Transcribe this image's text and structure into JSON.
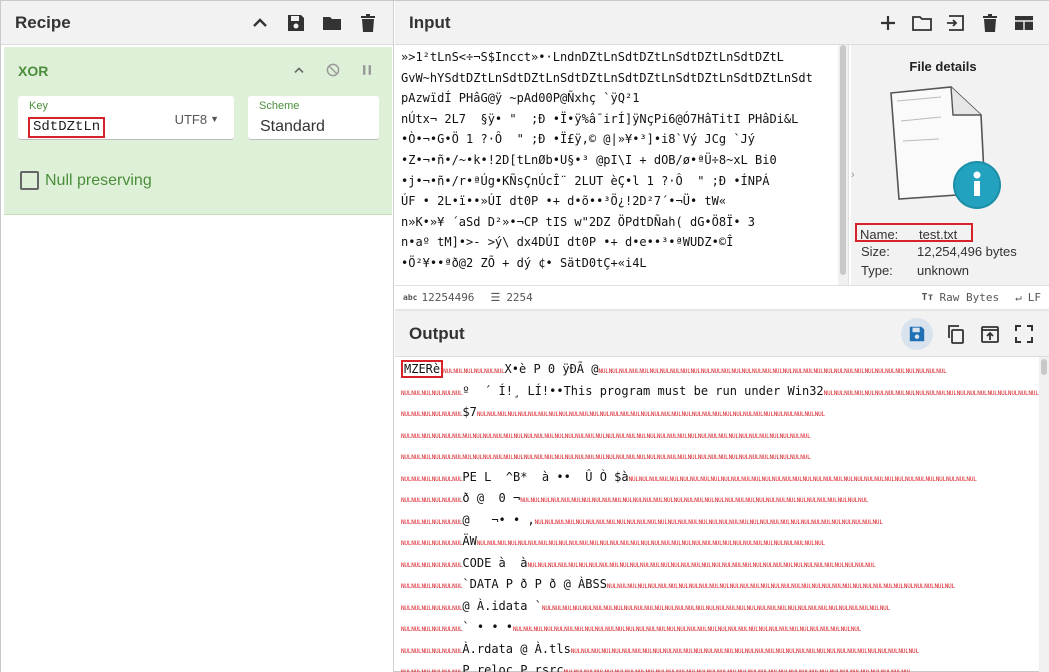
{
  "recipe": {
    "title": "Recipe",
    "operation": {
      "name": "XOR",
      "key_label": "Key",
      "key_value": "SdtDZtLn",
      "key_encoding": "UTF8",
      "scheme_label": "Scheme",
      "scheme_value": "Standard",
      "null_preserving_label": "Null preserving",
      "null_preserving_checked": false
    }
  },
  "input": {
    "title": "Input",
    "lines": [
      "»>1²tLnS<÷¬S$Incct»•·LndnDZtLnSdtDZtLnSdtDZtLnSdtDZtL",
      "GvW~hYSdtDZtLnSdtDZtLnSdtDZtLnSdtDZtLnSdtDZtLnSdtDZtLnSdt",
      "pAzwïdÍ PHâG@ÿ ~pAd00P@Ñxhç `ÿQ²1",
      "nÚtx¬ 2L7  §ÿ• \"  ;Ð •Ï•ÿ%â¯irÍ]ÿNçPi6@Ó7HâTitI PHâDi&L",
      "•Ò•¬•G•Ö 1 ?·Ô  \" ;Ð •Ï£ÿ,© @|»¥•³]•i8`Vý JCg `Jý",
      "•Z•¬•ñ•/~•k•!2D[tLnØb•U§•³ @pI\\I + dOB/ø•ªÜ÷8~xL Bi0",
      "•j•¬•ñ•/r•ªÚg•KÑsÇnÚcÎ¨ 2LUT èÇ•l 1 ?·Ô  \" ;Ð •ÍNPÁ",
      "ÚF • 2L•ï••»ÚI dt0P •+ d•õ••³Ö¿!2D²7´•¬Ü• tW«",
      "n»K•»¥ ´aSd D²»•¬CP tIS w\"2DZ ÖPdtDÑah( dG•Ö8Ï• 3",
      "n•aº tM]•>- >ý\\ dx4DÚI dt0P •+ d•e••³•ªWUDZ•©Î",
      "•Ö²¥••ªð@2 ZÕ + dý ¢• SätD0tÇ+«i4L"
    ],
    "char_count": "12254496",
    "line_count": "2254",
    "raw_bytes_label": "Raw Bytes",
    "file_details": {
      "title": "File details",
      "name_label": "Name:",
      "name_value": "test.txt",
      "size_label": "Size:",
      "size_value": "12,254,496 bytes",
      "type_label": "Type:",
      "type_value": "unknown"
    }
  },
  "output": {
    "title": "Output",
    "first_token": "MZERè",
    "lines": [
      "X•è P 0 ÿÐÃ @",
      "º  ´ Í!¸ LÍ!••This program must be run under Win32",
      "$7",
      "",
      "",
      "PE L  ^B*  à ••  Û Ò $à",
      "ð @  0 ¬",
      "@   ¬• • ,",
      "ÄW",
      "CODE à  à",
      "`DATA P ð P ð @ ÀBSS",
      "@ À.idata `",
      "` • • •",
      "À.rdata @ À.tls",
      "P.reloc P.rsrc"
    ]
  },
  "colors": {
    "accent_green": "#4a8e3b",
    "operation_bg": "#dff0d8",
    "highlight_red": "#d8222a",
    "header_bg": "#f2f2f2"
  }
}
